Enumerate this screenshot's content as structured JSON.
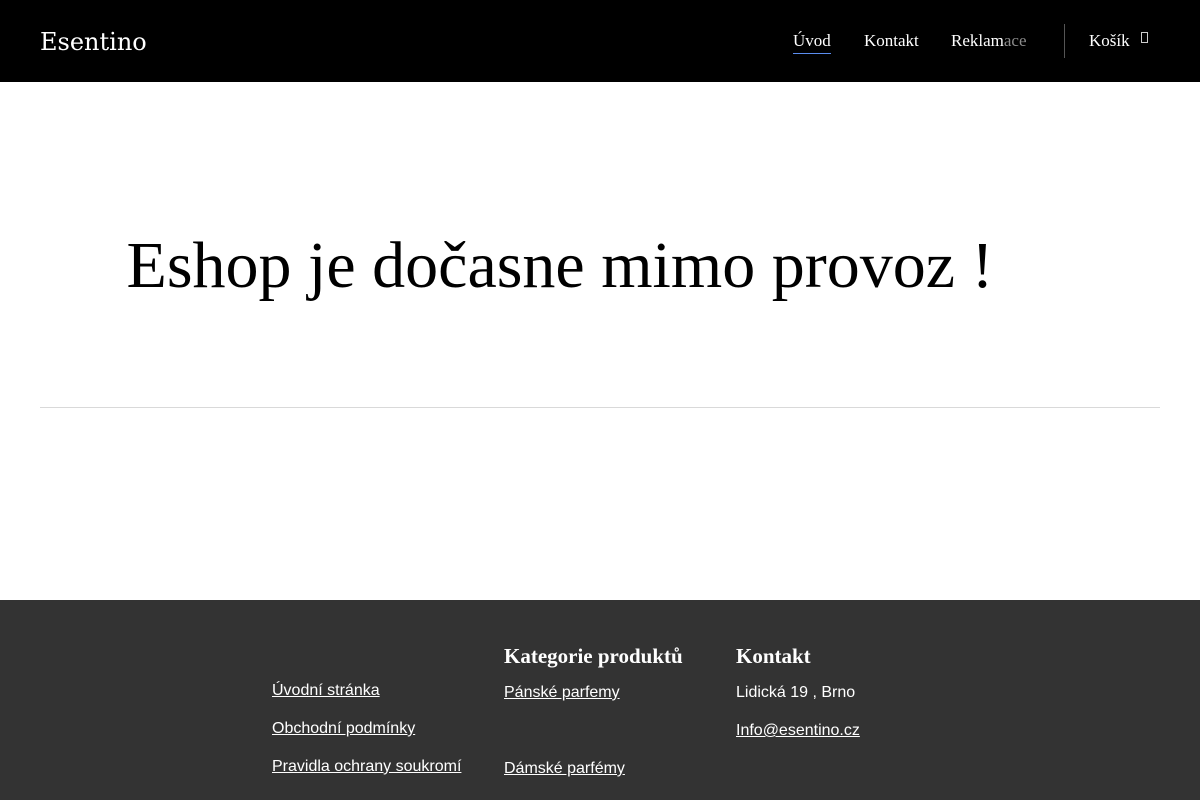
{
  "header": {
    "brand": "Esentino",
    "nav": {
      "uvod": "Úvod",
      "kontakt": "Kontakt",
      "reklamace_main": "Reklam",
      "reklamace_fade": "ace",
      "cart": "Košík"
    }
  },
  "main": {
    "heading": "Eshop je dočasne mimo provoz !"
  },
  "footer": {
    "links_col": {
      "items": [
        "Úvodní stránka",
        "Obchodní podmínky",
        "Pravidla ochrany soukromí"
      ]
    },
    "categories_col": {
      "title": "Kategorie produktů",
      "items": [
        "Pánské parfemy",
        "Dámské parfémy"
      ]
    },
    "contact_col": {
      "title": "Kontakt",
      "address": "Lidická 19 , Brno",
      "email": "Info@esentino.cz"
    }
  }
}
